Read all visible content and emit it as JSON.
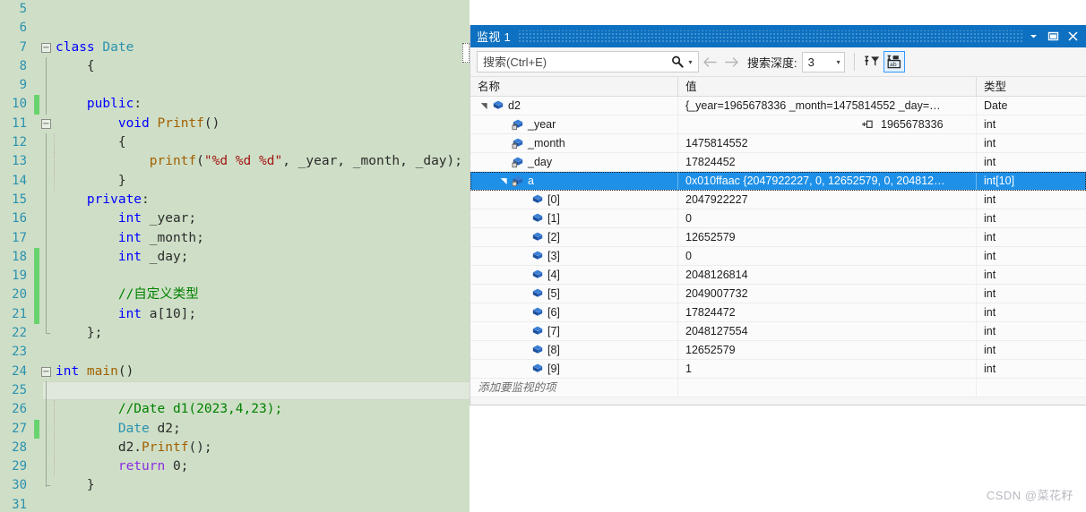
{
  "editor": {
    "first_line_number": 5,
    "lines": [
      {
        "n": 5,
        "fold": "",
        "modified": false,
        "tokens": []
      },
      {
        "n": 6,
        "fold": "",
        "modified": false,
        "tokens": []
      },
      {
        "n": 7,
        "fold": "minus",
        "modified": false,
        "tokens": [
          {
            "t": "class ",
            "c": "kw"
          },
          {
            "t": "Date",
            "c": "typ"
          }
        ],
        "indent": 0
      },
      {
        "n": 8,
        "fold": "bar",
        "modified": false,
        "tokens": [
          {
            "t": "{",
            "c": "pun"
          }
        ],
        "indent": 1
      },
      {
        "n": 9,
        "fold": "bar",
        "modified": false,
        "tokens": [],
        "indent": 1
      },
      {
        "n": 10,
        "fold": "bar",
        "modified": true,
        "tokens": [
          {
            "t": "public",
            "c": "kw"
          },
          {
            "t": ":",
            "c": "pun"
          }
        ],
        "indent": 1
      },
      {
        "n": 11,
        "fold": "minus2",
        "modified": false,
        "tokens": [
          {
            "t": "void ",
            "c": "kw"
          },
          {
            "t": "Printf",
            "c": "fn"
          },
          {
            "t": "()",
            "c": "pun"
          }
        ],
        "indent": 2
      },
      {
        "n": 12,
        "fold": "bar2",
        "modified": false,
        "tokens": [
          {
            "t": "{",
            "c": "pun"
          }
        ],
        "indent": 2
      },
      {
        "n": 13,
        "fold": "bar2",
        "modified": false,
        "tokens": [
          {
            "t": "printf",
            "c": "fn"
          },
          {
            "t": "(",
            "c": "pun"
          },
          {
            "t": "\"%d %d %d\"",
            "c": "str"
          },
          {
            "t": ", _year, _month, _day);",
            "c": "plain"
          }
        ],
        "indent": 3
      },
      {
        "n": 14,
        "fold": "bar2",
        "modified": false,
        "tokens": [
          {
            "t": "}",
            "c": "pun"
          }
        ],
        "indent": 2
      },
      {
        "n": 15,
        "fold": "bar",
        "modified": false,
        "tokens": [
          {
            "t": "private",
            "c": "kw"
          },
          {
            "t": ":",
            "c": "pun"
          }
        ],
        "indent": 1
      },
      {
        "n": 16,
        "fold": "bar",
        "modified": false,
        "tokens": [
          {
            "t": "int ",
            "c": "kw"
          },
          {
            "t": "_year;",
            "c": "plain"
          }
        ],
        "indent": 2
      },
      {
        "n": 17,
        "fold": "bar",
        "modified": false,
        "tokens": [
          {
            "t": "int ",
            "c": "kw"
          },
          {
            "t": "_month;",
            "c": "plain"
          }
        ],
        "indent": 2
      },
      {
        "n": 18,
        "fold": "bar",
        "modified": true,
        "tokens": [
          {
            "t": "int ",
            "c": "kw"
          },
          {
            "t": "_day;",
            "c": "plain"
          }
        ],
        "indent": 2
      },
      {
        "n": 19,
        "fold": "bar",
        "modified": true,
        "tokens": [],
        "indent": 2
      },
      {
        "n": 20,
        "fold": "bar",
        "modified": true,
        "tokens": [
          {
            "t": "//自定义类型",
            "c": "cmt"
          }
        ],
        "indent": 2
      },
      {
        "n": 21,
        "fold": "bar",
        "modified": true,
        "tokens": [
          {
            "t": "int ",
            "c": "kw"
          },
          {
            "t": "a[10];",
            "c": "plain"
          }
        ],
        "indent": 2
      },
      {
        "n": 22,
        "fold": "end",
        "modified": false,
        "tokens": [
          {
            "t": "};",
            "c": "pun"
          }
        ],
        "indent": 1
      },
      {
        "n": 23,
        "fold": "",
        "modified": false,
        "tokens": []
      },
      {
        "n": 24,
        "fold": "minus",
        "modified": false,
        "tokens": [
          {
            "t": "int ",
            "c": "kw"
          },
          {
            "t": "main",
            "c": "fn"
          },
          {
            "t": "()",
            "c": "pun"
          }
        ],
        "indent": 0
      },
      {
        "n": 25,
        "fold": "bar",
        "modified": false,
        "tokens": [
          {
            "t": "{",
            "c": "pun"
          }
        ],
        "indent": 1,
        "current": true
      },
      {
        "n": 26,
        "fold": "bar2",
        "modified": false,
        "tokens": [
          {
            "t": "//Date d1(2023,4,23);",
            "c": "cmt"
          }
        ],
        "indent": 2
      },
      {
        "n": 27,
        "fold": "bar2",
        "modified": true,
        "tokens": [
          {
            "t": "Date",
            "c": "typ"
          },
          {
            "t": " d2;",
            "c": "plain"
          }
        ],
        "indent": 2
      },
      {
        "n": 28,
        "fold": "bar2",
        "modified": false,
        "tokens": [
          {
            "t": "d2.",
            "c": "plain"
          },
          {
            "t": "Printf",
            "c": "fn"
          },
          {
            "t": "();",
            "c": "pun"
          }
        ],
        "indent": 2
      },
      {
        "n": 29,
        "fold": "bar2",
        "modified": false,
        "tokens": [
          {
            "t": "return ",
            "c": "kw2"
          },
          {
            "t": "0;",
            "c": "plain"
          }
        ],
        "indent": 2
      },
      {
        "n": 30,
        "fold": "end",
        "modified": false,
        "tokens": [
          {
            "t": "}",
            "c": "pun"
          }
        ],
        "indent": 1
      },
      {
        "n": 31,
        "fold": "",
        "modified": false,
        "tokens": []
      }
    ]
  },
  "watch": {
    "title": "监视 1",
    "title_buttons": {
      "dropdown": "chevron-down-icon",
      "maximize": "window-icon",
      "close": "close-icon"
    },
    "toolbar": {
      "search_placeholder": "搜索(Ctrl+E)",
      "search_value": "",
      "search_icon": "search-icon",
      "search_dropdown": "chevron-down-icon",
      "back_label": "←",
      "forward_label": "→",
      "depth_label": "搜索深度:",
      "depth_value": "3",
      "depth_caret": "▾",
      "pin_button": "pin-filter-icon",
      "hex_button": "value-display-icon"
    },
    "columns": {
      "name": "名称",
      "value": "值",
      "type": "类型"
    },
    "add_row_placeholder": "添加要监视的项",
    "rows": [
      {
        "indent": 0,
        "expander": "▲",
        "icon": "object-icon",
        "name": "d2",
        "value": "{_year=1965678336 _month=1475814552 _day=…",
        "type": "Date",
        "selected": false,
        "pinned": false
      },
      {
        "indent": 1,
        "expander": "",
        "icon": "private-field-icon",
        "name": "_year",
        "value": "1965678336",
        "type": "int",
        "selected": false,
        "pinned": true
      },
      {
        "indent": 1,
        "expander": "",
        "icon": "private-field-icon",
        "name": "_month",
        "value": "1475814552",
        "type": "int",
        "selected": false,
        "pinned": false
      },
      {
        "indent": 1,
        "expander": "",
        "icon": "private-field-icon",
        "name": "_day",
        "value": "17824452",
        "type": "int",
        "selected": false,
        "pinned": false
      },
      {
        "indent": 1,
        "expander": "▲",
        "icon": "private-field-icon",
        "name": "a",
        "value": "0x010ffaac {2047922227, 0, 12652579, 0, 204812…",
        "type": "int[10]",
        "selected": true,
        "pinned": false
      },
      {
        "indent": 2,
        "expander": "",
        "icon": "element-icon",
        "name": "[0]",
        "value": "2047922227",
        "type": "int",
        "selected": false,
        "pinned": false
      },
      {
        "indent": 2,
        "expander": "",
        "icon": "element-icon",
        "name": "[1]",
        "value": "0",
        "type": "int",
        "selected": false,
        "pinned": false
      },
      {
        "indent": 2,
        "expander": "",
        "icon": "element-icon",
        "name": "[2]",
        "value": "12652579",
        "type": "int",
        "selected": false,
        "pinned": false
      },
      {
        "indent": 2,
        "expander": "",
        "icon": "element-icon",
        "name": "[3]",
        "value": "0",
        "type": "int",
        "selected": false,
        "pinned": false
      },
      {
        "indent": 2,
        "expander": "",
        "icon": "element-icon",
        "name": "[4]",
        "value": "2048126814",
        "type": "int",
        "selected": false,
        "pinned": false
      },
      {
        "indent": 2,
        "expander": "",
        "icon": "element-icon",
        "name": "[5]",
        "value": "2049007732",
        "type": "int",
        "selected": false,
        "pinned": false
      },
      {
        "indent": 2,
        "expander": "",
        "icon": "element-icon",
        "name": "[6]",
        "value": "17824472",
        "type": "int",
        "selected": false,
        "pinned": false
      },
      {
        "indent": 2,
        "expander": "",
        "icon": "element-icon",
        "name": "[7]",
        "value": "2048127554",
        "type": "int",
        "selected": false,
        "pinned": false
      },
      {
        "indent": 2,
        "expander": "",
        "icon": "element-icon",
        "name": "[8]",
        "value": "12652579",
        "type": "int",
        "selected": false,
        "pinned": false
      },
      {
        "indent": 2,
        "expander": "",
        "icon": "element-icon",
        "name": "[9]",
        "value": "1",
        "type": "int",
        "selected": false,
        "pinned": false
      }
    ]
  },
  "watermark": "CSDN @菜花籽",
  "colors": {
    "editor_bg": "#cfdfc7",
    "title_bar": "#0e70c0",
    "selection": "#1e90e8",
    "change_bar": "#69d36e",
    "keyword": "#0000ff",
    "type": "#2b91af",
    "function": "#a06000",
    "string": "#a31515",
    "comment": "#008000"
  }
}
